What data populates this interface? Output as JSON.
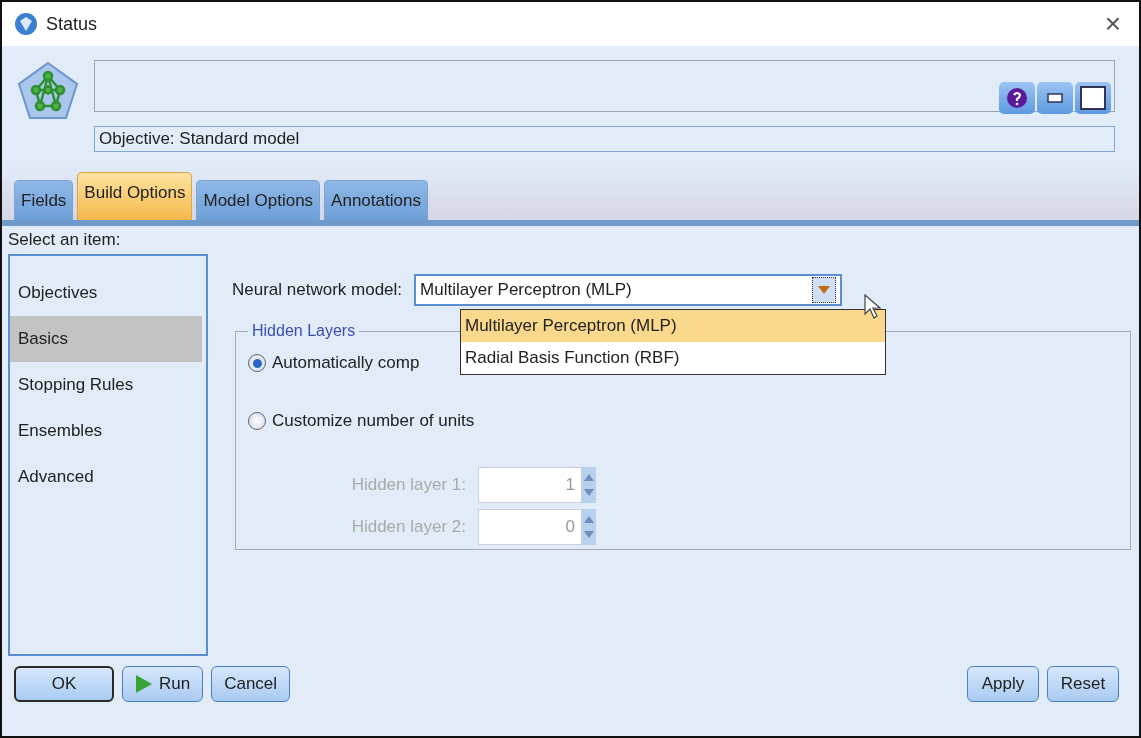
{
  "window": {
    "title": "Status",
    "close": "×"
  },
  "header": {
    "objective": "Objective: Standard model"
  },
  "tabs": [
    {
      "label": "Fields",
      "selected": false
    },
    {
      "label": "Build Options",
      "selected": true
    },
    {
      "label": "Model Options",
      "selected": false
    },
    {
      "label": "Annotations",
      "selected": false
    }
  ],
  "sidebar": {
    "label": "Select an item:",
    "items": [
      {
        "label": "Objectives",
        "selected": false
      },
      {
        "label": "Basics",
        "selected": true
      },
      {
        "label": "Stopping Rules",
        "selected": false
      },
      {
        "label": "Ensembles",
        "selected": false
      },
      {
        "label": "Advanced",
        "selected": false
      }
    ]
  },
  "model": {
    "label": "Neural network model:",
    "value": "Multilayer Perceptron (MLP)",
    "expanded": true,
    "options": [
      {
        "label": "Multilayer Perceptron (MLP)",
        "selected": true
      },
      {
        "label": "Radial Basis Function (RBF)",
        "selected": false
      }
    ]
  },
  "hidden_layers": {
    "legend": "Hidden Layers",
    "radios": [
      {
        "label": "Automatically comp",
        "selected": true
      },
      {
        "label": "Customize number of units",
        "selected": false
      }
    ],
    "spinners": [
      {
        "label": "Hidden layer 1:",
        "value": "1",
        "disabled": true
      },
      {
        "label": "Hidden layer 2:",
        "value": "0",
        "disabled": true
      }
    ]
  },
  "buttons_left": [
    {
      "kind": "default",
      "label": "OK"
    },
    {
      "kind": "run",
      "label": "Run"
    },
    {
      "kind": "plain",
      "label": "Cancel"
    }
  ],
  "buttons_right": [
    {
      "kind": "plain",
      "label": "Apply"
    },
    {
      "kind": "plain",
      "label": "Reset"
    }
  ]
}
